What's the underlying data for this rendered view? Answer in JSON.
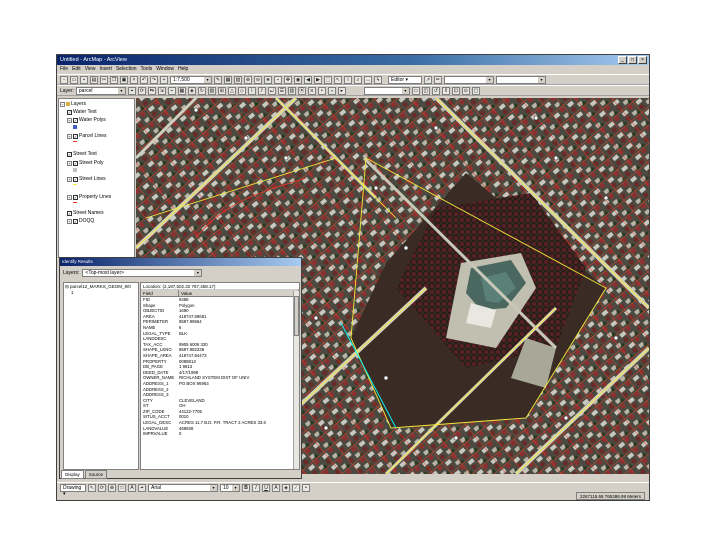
{
  "window": {
    "title": "Untitled - ArcMap - ArcView",
    "buttons": [
      "_",
      "□",
      "×"
    ]
  },
  "menubar": [
    "File",
    "Edit",
    "View",
    "Insert",
    "Selection",
    "Tools",
    "Window",
    "Help"
  ],
  "toolbar1": {
    "scale_value": "1:7,500",
    "editor_label": "Editor ▾"
  },
  "toolbar2": {
    "layer_label": "Layer:",
    "layer_value": "parcel"
  },
  "toc": {
    "root_label": "Layers",
    "items": [
      {
        "label": "Water Text",
        "indent": 1
      },
      {
        "label": "Water Polys",
        "indent": 1
      },
      {
        "label": "Parcel Lines",
        "indent": 1
      },
      {
        "label": "Street Text",
        "indent": 1
      },
      {
        "label": "Street Poly",
        "indent": 1
      },
      {
        "label": "Street Lines",
        "indent": 1
      },
      {
        "label": "Property Lines",
        "indent": 1
      },
      {
        "label": "Street Names",
        "indent": 1
      },
      {
        "label": "DOQQ",
        "indent": 1
      }
    ]
  },
  "identify": {
    "title": "Identify Results",
    "layers_label": "Layers:",
    "layers_value": "<Top-most layer>",
    "tree_root": "parcel12_MARKS_GEOM_9/0",
    "tree_child": "1",
    "location": "Location: (2,187,502.32 767,458.17)",
    "columns": [
      "Field",
      "Value"
    ],
    "rows": [
      [
        "FID",
        "9488"
      ],
      [
        "Shape",
        "Polygon"
      ],
      [
        "OBJECTID",
        "1690"
      ],
      [
        "AREA",
        "418747.69681"
      ],
      [
        "PERIMETER",
        "8597.98564"
      ],
      [
        "NAME",
        "6"
      ],
      [
        "LEGAL_TYPE",
        "BLK"
      ],
      [
        "LANDDESC",
        ""
      ],
      [
        "TAX_ACC",
        "9905 6006 330"
      ],
      [
        "SHAPE_LENG",
        "8597.982338"
      ],
      [
        "SHAPE_AREA",
        "418747.84473"
      ],
      [
        "PROPERTY",
        "0088813"
      ],
      [
        "DB_PAGE",
        "1 9813"
      ],
      [
        "DEED_DATE",
        "4/17/1998"
      ],
      [
        "OWNER_NAME",
        "RICHLAND SYSTEM DIST OF UNIV"
      ],
      [
        "ADDRESS_1",
        "PO BOX 96963"
      ],
      [
        "ADDRESS_2",
        ""
      ],
      [
        "ADDRESS_3",
        ""
      ],
      [
        "CITY",
        "CLEVELAND"
      ],
      [
        "ST",
        "OH"
      ],
      [
        "ZIP_CODE",
        "44122-7705"
      ],
      [
        "SITUS_ACCT",
        "0010"
      ],
      [
        "LEGAL_DESC",
        "ACRES 11.7 B.D. P.R. TRACT 2 ACRES 33.6"
      ],
      [
        "LANDVALUE",
        "468938"
      ],
      [
        "IMPRVALUE",
        "0"
      ]
    ],
    "tabs": [
      "Display",
      "Source"
    ]
  },
  "drawbar": {
    "drawing_label": "Drawing ▾",
    "font_value": "Arial",
    "size_value": "10"
  },
  "status": {
    "coords": "2267115.68 765386.99 Meters"
  },
  "colors": {
    "titlebar": "#0a246a",
    "parcel_line": "#e53a2a",
    "road_line": "#f4ea3a",
    "selection": "#00ffff"
  }
}
